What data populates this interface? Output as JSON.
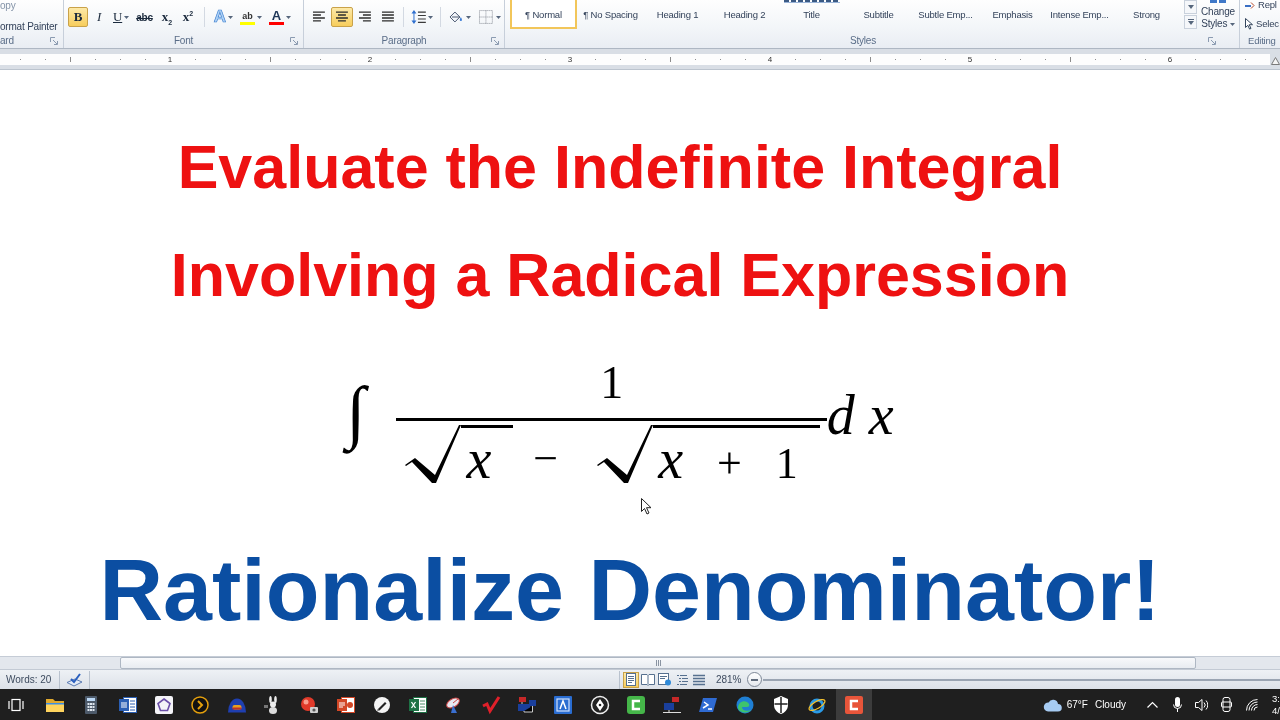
{
  "ribbon": {
    "clipboard": {
      "buttons": [
        "opy",
        "ormat Painter"
      ],
      "label": "ard"
    },
    "font": {
      "buttons": [
        {
          "kind": "bold",
          "label": "B",
          "selected": true,
          "dropdown": false
        },
        {
          "kind": "italic",
          "label": "I",
          "selected": false,
          "dropdown": false
        },
        {
          "kind": "underline",
          "label": "U",
          "selected": false,
          "dropdown": true
        },
        {
          "kind": "strikethrough",
          "label": "abc",
          "selected": false,
          "dropdown": false
        },
        {
          "kind": "subscript",
          "label": "x$_{2}$",
          "selected": false,
          "dropdown": false
        },
        {
          "kind": "superscript",
          "label": "x$^{2}$",
          "selected": false,
          "dropdown": false
        },
        {
          "kind": "text_effects",
          "label": "A",
          "selected": false,
          "dropdown": true
        },
        {
          "kind": "highlight",
          "label": "ab",
          "color": "#ffff00",
          "selected": false,
          "dropdown": true
        },
        {
          "kind": "font_color",
          "label": "A",
          "color": "#ff0000",
          "selected": false,
          "dropdown": true
        }
      ],
      "label": "Font"
    },
    "paragraph": {
      "buttons": [
        {
          "kind": "align_left",
          "selected": false,
          "dropdown": false
        },
        {
          "kind": "align_center",
          "selected": true,
          "dropdown": false
        },
        {
          "kind": "align_right",
          "selected": false,
          "dropdown": false
        },
        {
          "kind": "justify",
          "selected": false,
          "dropdown": false
        },
        {
          "kind": "line_spacing",
          "selected": false,
          "dropdown": true
        },
        {
          "kind": "shading",
          "selected": false,
          "dropdown": true
        },
        {
          "kind": "borders",
          "selected": false,
          "dropdown": true
        }
      ],
      "label": "Paragraph"
    },
    "styles": {
      "gallery": [
        {
          "kind": "normal",
          "label": "¶ Normal",
          "selected": true
        },
        {
          "kind": "no_spacing",
          "label": "¶ No Spacing",
          "selected": false
        },
        {
          "kind": "heading_1",
          "label": "Heading 1",
          "selected": false
        },
        {
          "kind": "heading_2",
          "label": "Heading 2",
          "selected": false
        },
        {
          "kind": "title",
          "label": "Title",
          "selected": false
        },
        {
          "kind": "subtitle",
          "label": "Subtitle",
          "selected": false
        },
        {
          "kind": "subtle_emphasis",
          "label": "Subtle Emp...",
          "selected": false
        },
        {
          "kind": "emphasis",
          "label": "Emphasis",
          "selected": false
        },
        {
          "kind": "intense_emphasis",
          "label": "Intense Emp...",
          "selected": false
        },
        {
          "kind": "strong",
          "label": "Strong",
          "selected": false
        }
      ],
      "change_styles": "Change Styles",
      "label": "Styles"
    },
    "editing": {
      "buttons": [
        "Repl",
        "Selec"
      ],
      "label": "Editing"
    }
  },
  "ruler": {
    "numbers": [
      "1",
      "2",
      "3",
      "4",
      "5",
      "6"
    ]
  },
  "document": {
    "title_lines": [
      "Evaluate the Indefinite Integral",
      "Involving a Radical Expression"
    ],
    "formula": {
      "integral": "∫",
      "numerator": "1",
      "denominator": [
        {
          "kind": "radical",
          "terms": [
            {
              "kind": "variable",
              "text": "x"
            }
          ]
        },
        {
          "kind": "operator",
          "text": "−"
        },
        {
          "kind": "radical",
          "terms": [
            {
              "kind": "variable",
              "text": "x"
            },
            {
              "kind": "operator",
              "text": "+"
            },
            {
              "kind": "number",
              "text": "1"
            }
          ]
        }
      ],
      "differential": "d x"
    },
    "tagline": "Rationalize Denominator!"
  },
  "status_bar": {
    "word_count": "Words: 20",
    "views": [
      {
        "kind": "print_layout",
        "selected": true
      },
      {
        "kind": "full_screen_reading",
        "selected": false
      },
      {
        "kind": "web_layout",
        "selected": false
      },
      {
        "kind": "outline",
        "selected": false
      },
      {
        "kind": "draft",
        "selected": false
      }
    ],
    "zoom": "281%"
  },
  "taskbar": {
    "apps": [
      {
        "selected": false
      },
      {
        "selected": false
      },
      {
        "selected": false
      },
      {
        "selected": false
      },
      {
        "selected": false
      },
      {
        "selected": false
      },
      {
        "selected": false
      },
      {
        "selected": false
      },
      {
        "selected": false
      },
      {
        "selected": false
      },
      {
        "selected": false
      },
      {
        "selected": false
      },
      {
        "selected": false
      },
      {
        "selected": false
      },
      {
        "selected": false
      },
      {
        "selected": false
      },
      {
        "selected": false
      },
      {
        "selected": false
      },
      {
        "selected": false
      },
      {
        "selected": false
      },
      {
        "selected": false
      },
      {
        "selected": false
      },
      {
        "selected": true
      }
    ],
    "weather": {
      "temperature": "67°F",
      "condition": "Cloudy"
    },
    "clock": {
      "time": "3:",
      "date": "4/"
    }
  }
}
